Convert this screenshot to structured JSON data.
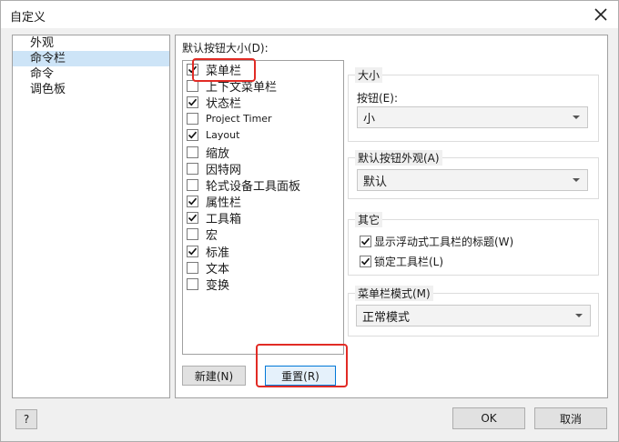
{
  "window": {
    "title": "自定义"
  },
  "nav": {
    "items": [
      "外观",
      "命令栏",
      "命令",
      "调色板"
    ]
  },
  "main": {
    "section_label": "默认按钮大小(D):",
    "commandbars": [
      {
        "label": "菜单栏",
        "checked": true
      },
      {
        "label": "上下文菜单栏",
        "checked": false
      },
      {
        "label": "状态栏",
        "checked": true
      },
      {
        "label": "Project Timer",
        "checked": false
      },
      {
        "label": "Layout",
        "checked": true
      },
      {
        "label": "缩放",
        "checked": false
      },
      {
        "label": "因特网",
        "checked": false
      },
      {
        "label": "轮式设备工具面板",
        "checked": false
      },
      {
        "label": "属性栏",
        "checked": true
      },
      {
        "label": "工具箱",
        "checked": true
      },
      {
        "label": "宏",
        "checked": false
      },
      {
        "label": "标准",
        "checked": true
      },
      {
        "label": "文本",
        "checked": false
      },
      {
        "label": "变换",
        "checked": false
      }
    ],
    "new_label": "新建(N)",
    "reset_label": "重置(R)"
  },
  "size_group": {
    "title": "大小",
    "button_label": "按钮(E):",
    "button_value": "小"
  },
  "appearance_group": {
    "title": "默认按钮外观(A)",
    "value": "默认"
  },
  "other_group": {
    "title": "其它",
    "options": [
      {
        "label": "显示浮动式工具栏的标题(W)",
        "checked": true
      },
      {
        "label": "锁定工具栏(L)",
        "checked": true
      }
    ]
  },
  "menubar_mode_group": {
    "title": "菜单栏模式(M)",
    "value": "正常模式"
  },
  "footer": {
    "help_label": "?",
    "ok_label": "OK",
    "cancel_label": "取消"
  },
  "annotation_color": "#e12b25"
}
